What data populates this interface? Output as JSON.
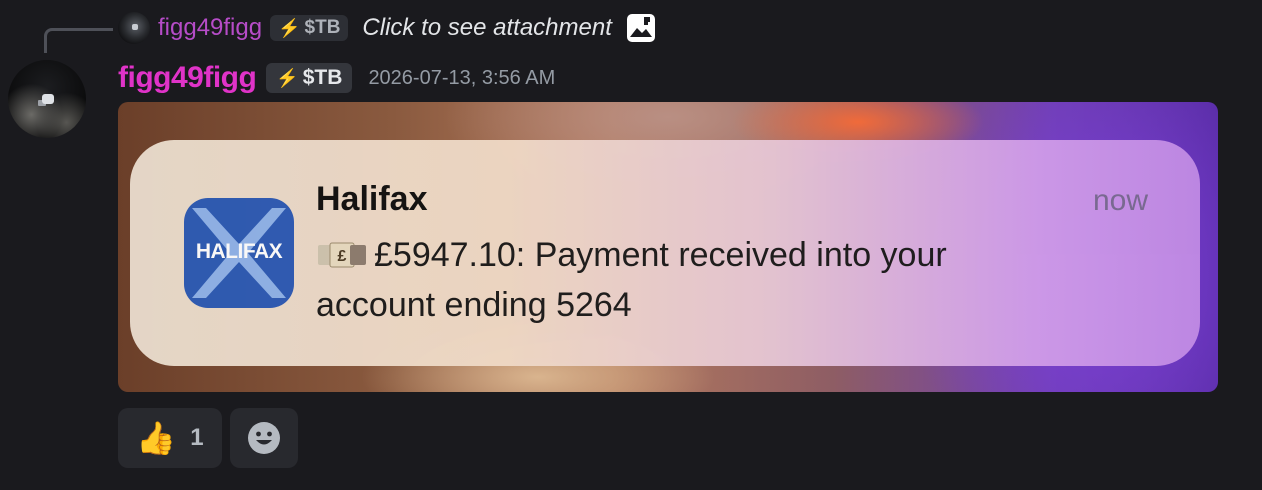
{
  "reply": {
    "username": "figg49figg",
    "tag_label": "$TB",
    "text": "Click to see attachment",
    "image_icon": "image-icon"
  },
  "message": {
    "username": "figg49figg",
    "tag_label": "$TB",
    "timestamp": "2026-07-13, 3:56 AM",
    "username_color": "#e033c8"
  },
  "attachment": {
    "notification": {
      "app_icon_label": "HALIFAX",
      "app_name": "Halifax",
      "time": "now",
      "money_icon": "money-with-wings-icon",
      "body_line1": "£5947.10: Payment received into your",
      "body_line2": "account ending 5264"
    }
  },
  "reactions": [
    {
      "emoji": "👍",
      "icon": "thumbs-up-icon",
      "count": "1"
    },
    {
      "icon": "add-reaction-icon"
    }
  ]
}
